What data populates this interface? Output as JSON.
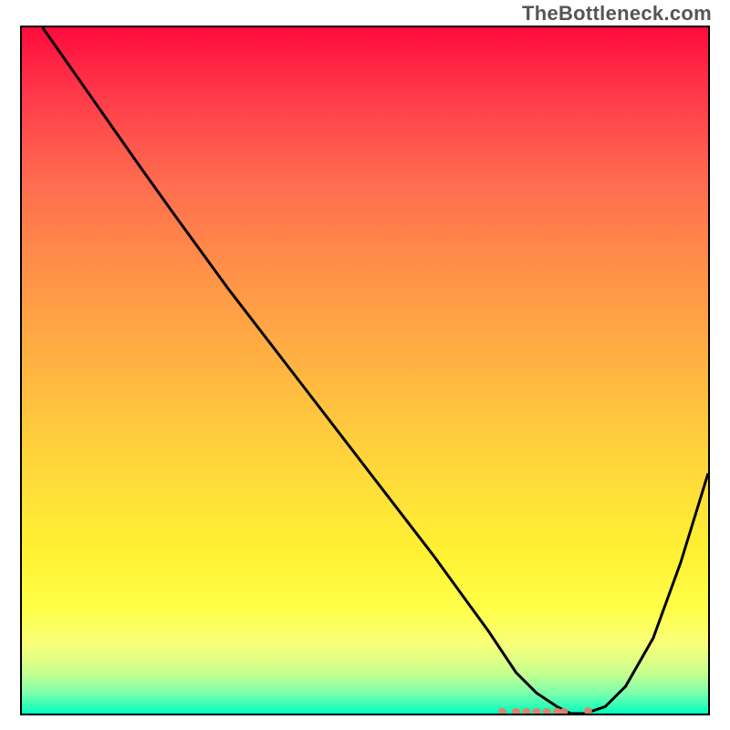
{
  "watermark": "TheBottleneck.com",
  "colors": {
    "curve_stroke": "#000000",
    "marker_fill": "#e0816d",
    "border": "#000000"
  },
  "chart_data": {
    "type": "line",
    "title": "",
    "xlabel": "",
    "ylabel": "",
    "xlim": [
      0,
      100
    ],
    "ylim": [
      0,
      100
    ],
    "grid": false,
    "series": [
      {
        "name": "bottleneck-curve",
        "x": [
          3,
          10,
          17,
          22,
          30,
          40,
          50,
          60,
          68,
          72,
          75,
          78,
          80,
          82,
          85,
          88,
          92,
          96,
          100
        ],
        "y": [
          100,
          90,
          80,
          73,
          62,
          49,
          36,
          23,
          12,
          6,
          3,
          1,
          0,
          0,
          1,
          4,
          11,
          22,
          35
        ]
      }
    ],
    "markers": {
      "name": "bottom-cluster",
      "shape": "rounded-square",
      "points_x": [
        70,
        72,
        73.5,
        75,
        76.5,
        78,
        79,
        82.5
      ],
      "points_y": [
        0.3,
        0.3,
        0.3,
        0.3,
        0.3,
        0.3,
        0.3,
        0.4
      ]
    }
  }
}
